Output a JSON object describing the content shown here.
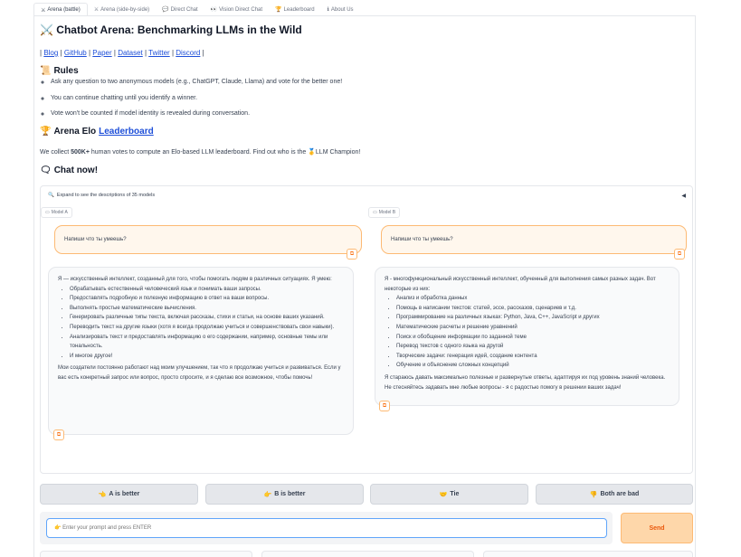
{
  "tabs": [
    {
      "icon": "⚔",
      "label": "Arena (battle)"
    },
    {
      "icon": "⚔",
      "label": "Arena (side-by-side)"
    },
    {
      "icon": "💬",
      "label": "Direct Chat"
    },
    {
      "icon": "👀",
      "label": "Vision Direct Chat"
    },
    {
      "icon": "🏆",
      "label": "Leaderboard"
    },
    {
      "icon": "ℹ",
      "label": "About Us"
    }
  ],
  "header": {
    "title": "⚔️ Chatbot Arena: Benchmarking LLMs in the Wild",
    "links": [
      "Blog",
      "GitHub",
      "Paper",
      "Dataset",
      "Twitter",
      "Discord"
    ]
  },
  "rules": {
    "heading": "Rules",
    "items": [
      "Ask any question to two anonymous models (e.g., ChatGPT, Claude, Llama) and vote for the better one!",
      "You can continue chatting until you identify a winner.",
      "Vote won't be counted if model identity is revealed during conversation."
    ]
  },
  "elo": {
    "heading_prefix": "Arena Elo",
    "heading_link": "Leaderboard",
    "text_before": "We collect ",
    "text_bold": "500K+",
    "text_after": " human votes to compute an Elo-based LLM leaderboard. Find out who is the 🥇LLM Champion!"
  },
  "chat_now": "Chat now!",
  "accordion_label": "Expand to see the descriptions of 35 models",
  "model_a": {
    "label": "Model A",
    "user_message": "Напиши что ты умеешь?",
    "intro": "Я — искусственный интеллект, созданный для того, чтобы помогать людям в различных ситуациях. Я умею:",
    "items": [
      "Обрабатывать естественный человеческий язык и понимать ваши запросы.",
      "Предоставлять подробную и полезную информацию в ответ на ваши вопросы.",
      "Выполнять простые математические вычисления.",
      "Генерировать различные типы текста, включая рассказы, стихи и статьи, на основе ваших указаний.",
      "Переводить текст на другие языки (хотя я всегда продолжаю учиться и совершенствовать свои навыки).",
      "Анализировать текст и предоставлять информацию о его содержании, например, основные темы или тональность.",
      "И многое другое!"
    ],
    "outro": "Мои создатели постоянно работают над моим улучшением, так что я продолжаю учиться и развиваться. Если у вас есть конкретный запрос или вопрос, просто спросите, и я сделаю все возможное, чтобы помочь!"
  },
  "model_b": {
    "label": "Model B",
    "user_message": "Напиши что ты умеешь?",
    "intro": "Я - многофункциональный искусственный интеллект, обученный для выполнения самых разных задач. Вот некоторые из них:",
    "items": [
      "Анализ и обработка данных",
      "Помощь в написании текстов: статей, эссе, рассказов, сценариев и т.д.",
      "Программирование на различных языках: Python, Java, C++, JavaScript и других",
      "Математические расчеты и решение уравнений",
      "Поиск и обобщение информации по заданной теме",
      "Перевод текстов с одного языка на другой",
      "Творческие задачи: генерация идей, создание контента",
      "Обучение и объяснение сложных концепций"
    ],
    "outro": "Я стараюсь давать максимально полезные и развернутые ответы, адаптируя их под уровень знаний человека. Не стесняйтесь задавать мне любые вопросы - я с радостью помогу в решении ваших задач!"
  },
  "votes": [
    {
      "icon": "👈",
      "label": "A is better"
    },
    {
      "icon": "👉",
      "label": "B is better"
    },
    {
      "icon": "🤝",
      "label": "Tie"
    },
    {
      "icon": "👎",
      "label": "Both are bad"
    }
  ],
  "prompt_placeholder": "👉 Enter your prompt and press ENTER",
  "send_label": "Send",
  "colors": {
    "accent": "#f97316",
    "link": "#1d4ed8",
    "input_border": "#60a5fa"
  }
}
